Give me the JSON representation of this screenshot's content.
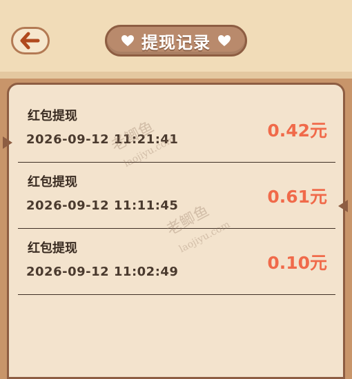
{
  "header": {
    "title": "提现记录"
  },
  "records": [
    {
      "title": "红包提现",
      "datetime": "2026-09-12  11:21:41",
      "amount": "0.42元"
    },
    {
      "title": "红包提现",
      "datetime": "2026-09-12  11:11:45",
      "amount": "0.61元"
    },
    {
      "title": "红包提现",
      "datetime": "2026-09-12  11:02:49",
      "amount": "0.10元"
    }
  ],
  "watermark": {
    "brand": "老鲫鱼",
    "domain": "laojiyu.com"
  },
  "colors": {
    "accent": "#f06a4a",
    "header_bg": "#f1dcb8",
    "panel_bg": "#f3e3cd",
    "frame": "#c8956a"
  }
}
